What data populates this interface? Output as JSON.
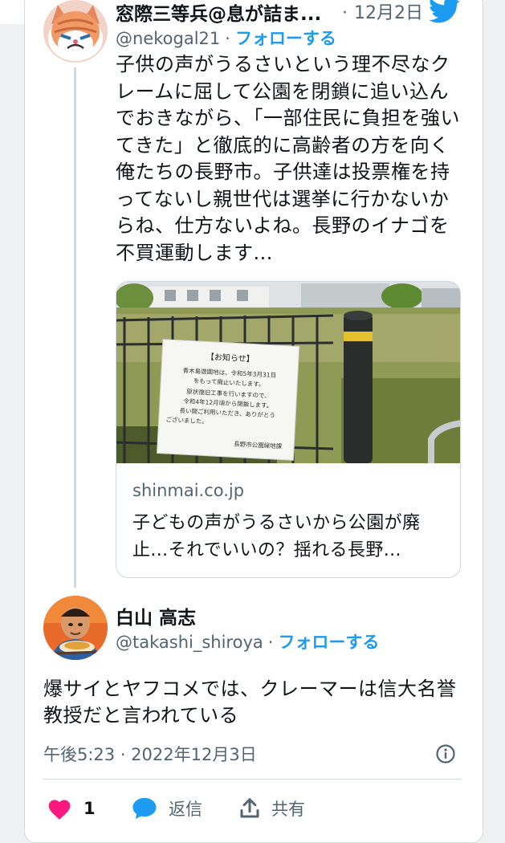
{
  "tweet1": {
    "display_name": "窓際三等兵@息が詰ま...",
    "date": "12月2日",
    "handle": "@nekogal21",
    "follow_label": "フォローする",
    "text": "子供の声がうるさいという理不尽なクレームに屈して公園を閉鎖に追い込んでおきながら、「一部住民に負担を強いてきた」と徹底的に高齢者の方を向く俺たちの長野市。子供達は投票権を持ってないし親世代は選挙に行かないからね、仕方ないよね。長野のイナゴを不買運動します...",
    "link": {
      "sign_title": "【お知らせ】",
      "sign_lines": [
        "青木島遊園地は、令和5年3月31日",
        "をもって廃止いたします。",
        "原状復旧工事を行いますので、",
        "令和4年12月頃から閉鎖します。",
        "長い間ご利用いただき、ありがとう",
        "ございました。"
      ],
      "sign_signature": "長野市公園緑地課",
      "domain": "shinmai.co.jp",
      "title": "子どもの声がうるさいから公園が廃止...それでいいの？揺れる長野..."
    }
  },
  "tweet2": {
    "display_name": "白山 高志",
    "handle": "@takashi_shiroya",
    "follow_label": "フォローする",
    "text": "爆サイとヤフコメでは、クレーマーは信大名誉教授だと言われている",
    "timestamp": "午後5:23 · 2022年12月3日"
  },
  "actions": {
    "like_count": "1",
    "reply_label": "返信",
    "share_label": "共有"
  },
  "separator": "·",
  "icons": {
    "brand": "twitter-bird-icon",
    "info": "info-icon",
    "like": "heart-icon",
    "reply": "chat-bubble-icon",
    "share": "share-icon"
  },
  "colors": {
    "accent": "#1d9bf0",
    "like": "#f91880",
    "text": "#0f1419",
    "secondary": "#536471",
    "border": "#cfd9de"
  }
}
